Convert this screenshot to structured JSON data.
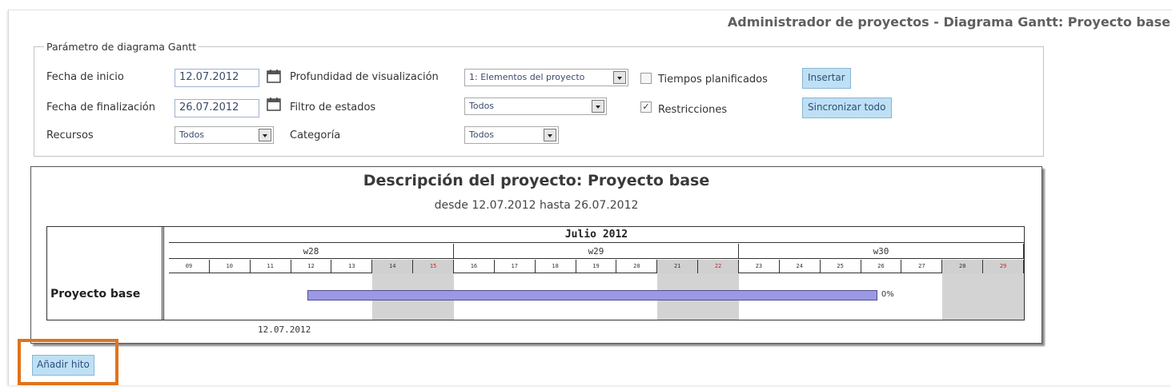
{
  "header": {
    "title": "Administrador de proyectos - Diagrama Gantt: Proyecto base"
  },
  "params": {
    "legend": "Parámetro de diagrama Gantt",
    "start_label": "Fecha de inicio",
    "start_value": "12.07.2012",
    "end_label": "Fecha de finalización",
    "end_value": "26.07.2012",
    "resources_label": "Recursos",
    "resources_value": "Todos",
    "depth_label": "Profundidad de visualización",
    "depth_value": "1: Elementos del proyecto",
    "status_filter_label": "Filtro de estados",
    "status_filter_value": "Todos",
    "category_label": "Categoría",
    "category_value": "Todos",
    "planned_times_label": "Tiempos planificados",
    "planned_times_checked": false,
    "restrictions_label": "Restricciones",
    "restrictions_checked": true,
    "restrictions_mark": "✓",
    "insert_button": "Insertar",
    "sync_button": "Sincronizar todo"
  },
  "chart": {
    "title": "Descripción del proyecto: Proyecto base",
    "subtitle": "desde 12.07.2012 hasta 26.07.2012",
    "month": "Julio 2012",
    "weeks": [
      "w28",
      "w29",
      "w30"
    ],
    "days": [
      "09",
      "10",
      "11",
      "12",
      "13",
      "14",
      "15",
      "16",
      "17",
      "18",
      "19",
      "20",
      "21",
      "22",
      "23",
      "24",
      "25",
      "26",
      "27",
      "28",
      "29"
    ],
    "row_name": "Proyecto base",
    "bar_start": "12.07.2012",
    "bar_end": "26.07.2012",
    "percent": "0%",
    "date_label": "12.07.2012"
  },
  "actions": {
    "add_milestone_button": "Añadir hito"
  },
  "colors": {
    "bar": "#9b98e6",
    "weekend": "#d0d0d0",
    "highlight": "#e0731c",
    "button": "#bfe0f4"
  }
}
